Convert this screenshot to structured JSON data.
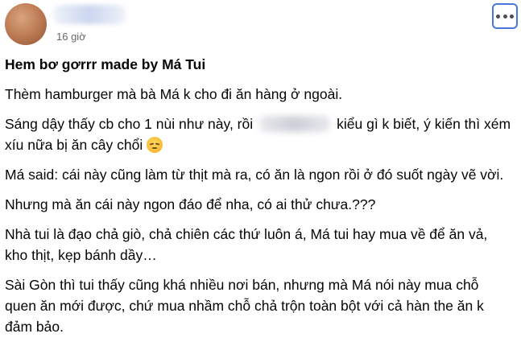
{
  "post": {
    "time": "16 giờ",
    "title": "Hem bơ gơrrr made by Má Tui",
    "p1": "Thèm hamburger mà bà Má k cho đi ăn hàng ở ngoài.",
    "p2_a": "Sáng dậy thấy cb cho 1 nùi như này, rồi",
    "p2_b": "kiểu gì k biết, ý kiến thì xém xíu nữa bị ăn cây chổi",
    "p3": "Má said: cái này cũng làm từ thịt mà ra, có ăn là ngon rồi ở đó suốt ngày vẽ vời.",
    "p4": "Nhưng mà ăn cái này ngon đáo để nha, có ai thử chưa.???",
    "p5": "Nhà tui là đạo chả giò, chả chiên các thứ luôn á, Má tui hay mua về để ăn vả, kho thịt, kẹp bánh dầy…",
    "p6": "Sài Gòn thì tui thấy cũng khá nhiều nơi bán, nhưng mà Má nói này mua chỗ quen ăn mới được, chứ mua nhầm chỗ chả trộn toàn bột với cả hàn the ăn k đảm bảo."
  },
  "icons": {
    "more": "more-horizontal-icon",
    "emoji": "disappointed-face-emoji"
  },
  "colors": {
    "text": "#050505",
    "meta": "#65676b",
    "focus_border": "#4a78d6"
  }
}
